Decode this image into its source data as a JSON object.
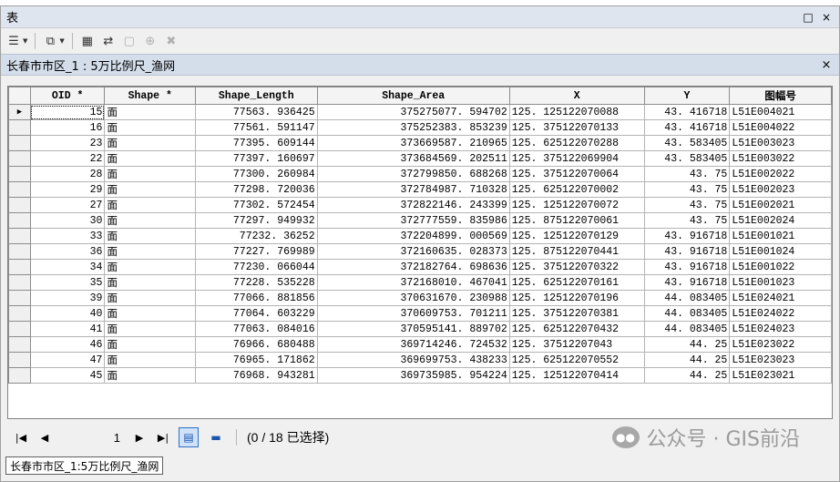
{
  "window": {
    "title": "表",
    "restore_icon": "□",
    "close_icon": "×"
  },
  "toolbar": {
    "icons": [
      "table-options-icon",
      "related-tables-icon",
      "select-by-attributes-icon",
      "switch-selection-icon",
      "clear-selection-icon",
      "zoom-to-selected-icon",
      "delete-selected-icon"
    ]
  },
  "tab": {
    "title": "长春市市区_1 : 5万比例尺_渔网",
    "close": "×"
  },
  "table": {
    "columns": [
      "OID *",
      "Shape *",
      "Shape_Length",
      "Shape_Area",
      "X",
      "Y",
      "图幅号"
    ],
    "rows": [
      [
        "15",
        "面",
        "77563. 936425",
        "375275077. 594702",
        "125. 125122070088",
        "43. 416718",
        "L51E004021"
      ],
      [
        "16",
        "面",
        "77561. 591147",
        "375252383. 853239",
        "125. 375122070133",
        "43. 416718",
        "L51E004022"
      ],
      [
        "23",
        "面",
        "77395. 609144",
        "373669587. 210965",
        "125. 625122070288",
        "43. 583405",
        "L51E003023"
      ],
      [
        "22",
        "面",
        "77397. 160697",
        "373684569. 202511",
        "125. 375122069904",
        "43. 583405",
        "L51E003022"
      ],
      [
        "28",
        "面",
        "77300. 260984",
        "372799850. 688268",
        "125. 375122070064",
        "43. 75",
        "L51E002022"
      ],
      [
        "29",
        "面",
        "77298. 720036",
        "372784987. 710328",
        "125. 625122070002",
        "43. 75",
        "L51E002023"
      ],
      [
        "27",
        "面",
        "77302. 572454",
        "372822146. 243399",
        "125. 125122070072",
        "43. 75",
        "L51E002021"
      ],
      [
        "30",
        "面",
        "77297. 949932",
        "372777559. 835986",
        "125. 875122070061",
        "43. 75",
        "L51E002024"
      ],
      [
        "33",
        "面",
        "77232. 36252",
        "372204899. 000569",
        "125. 125122070129",
        "43. 916718",
        "L51E001021"
      ],
      [
        "36",
        "面",
        "77227. 769989",
        "372160635. 028373",
        "125. 875122070441",
        "43. 916718",
        "L51E001024"
      ],
      [
        "34",
        "面",
        "77230. 066044",
        "372182764. 698636",
        "125. 375122070322",
        "43. 916718",
        "L51E001022"
      ],
      [
        "35",
        "面",
        "77228. 535228",
        "372168010. 467041",
        "125. 625122070161",
        "43. 916718",
        "L51E001023"
      ],
      [
        "39",
        "面",
        "77066. 881856",
        "370631670. 230988",
        "125. 125122070196",
        "44. 083405",
        "L51E024021"
      ],
      [
        "40",
        "面",
        "77064. 603229",
        "370609753. 701211",
        "125. 375122070381",
        "44. 083405",
        "L51E024022"
      ],
      [
        "41",
        "面",
        "77063. 084016",
        "370595141. 889702",
        "125. 625122070432",
        "44. 083405",
        "L51E024023"
      ],
      [
        "46",
        "面",
        "76966. 680488",
        "369714246. 724532",
        "125. 37512207043",
        "44. 25",
        "L51E023022"
      ],
      [
        "47",
        "面",
        "76965. 171862",
        "369699753. 438233",
        "125. 625122070552",
        "44. 25",
        "L51E023023"
      ],
      [
        "45",
        "面",
        "76968. 943281",
        "369735985. 954224",
        "125. 125122070414",
        "44. 25",
        "L51E023021"
      ]
    ]
  },
  "nav": {
    "first": "⏮",
    "prev": "◀",
    "record": "1",
    "next": "▶",
    "last": "⏭",
    "selection_text": "(0 / 18 已选择)"
  },
  "watermark": {
    "text": "公众号 · GIS前沿"
  },
  "bottom_tab": {
    "label": "长春市市区_1:5万比例尺_渔网"
  }
}
